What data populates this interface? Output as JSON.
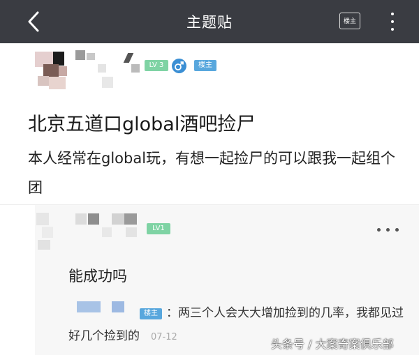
{
  "header": {
    "title": "主题贴",
    "owner_button": "楼主",
    "back_icon": "chevron-left-icon",
    "more_icon": "more-vertical-icon"
  },
  "post": {
    "level_badge": "LV 3",
    "gender_icon": "male-icon",
    "owner_badge": "楼主",
    "title": "北京五道口global酒吧捡尸",
    "body": "本人经常在global玩，有想一起捡尸的可以跟我一起组个团"
  },
  "reply": {
    "level_badge": "LV1",
    "text": "能成功吗",
    "more_icon": "more-horizontal-icon",
    "sub_reply": {
      "owner_badge": "楼主",
      "text": "：两三个人会大大增加捡到的几率，我都见过好几个捡到的",
      "date": "07-12"
    }
  },
  "watermark": "头条号 / 大案奇案俱乐部",
  "colors": {
    "header_bg": "#3a3c42",
    "level_green": "#7fd3a4",
    "owner_blue": "#58a7dd",
    "gender_blue": "#3b8fd4"
  }
}
